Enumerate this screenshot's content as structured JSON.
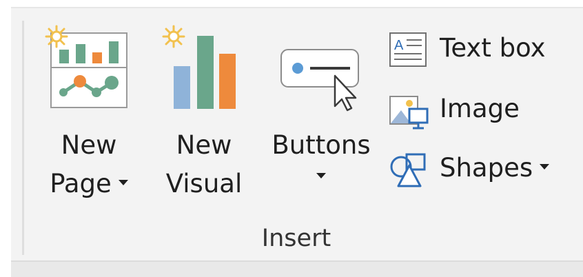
{
  "ribbon": {
    "group_label": "Insert",
    "new_page": {
      "label_line1": "New",
      "label_line2": "Page",
      "icon": "new-page-icon"
    },
    "new_visual": {
      "label_line1": "New",
      "label_line2": "Visual",
      "icon": "new-visual-icon"
    },
    "buttons": {
      "label": "Buttons",
      "icon": "button-with-cursor-icon"
    },
    "text_box": {
      "label": "Text box",
      "icon": "text-box-icon"
    },
    "image": {
      "label": "Image",
      "icon": "image-icon"
    },
    "shapes": {
      "label": "Shapes",
      "icon": "shapes-icon"
    }
  },
  "colors": {
    "sparkle": "#f2c14e",
    "bar_green": "#6aa68b",
    "bar_orange": "#ee8a3c",
    "bar_blue": "#8fb3d9",
    "icon_blue": "#2f6db6"
  }
}
